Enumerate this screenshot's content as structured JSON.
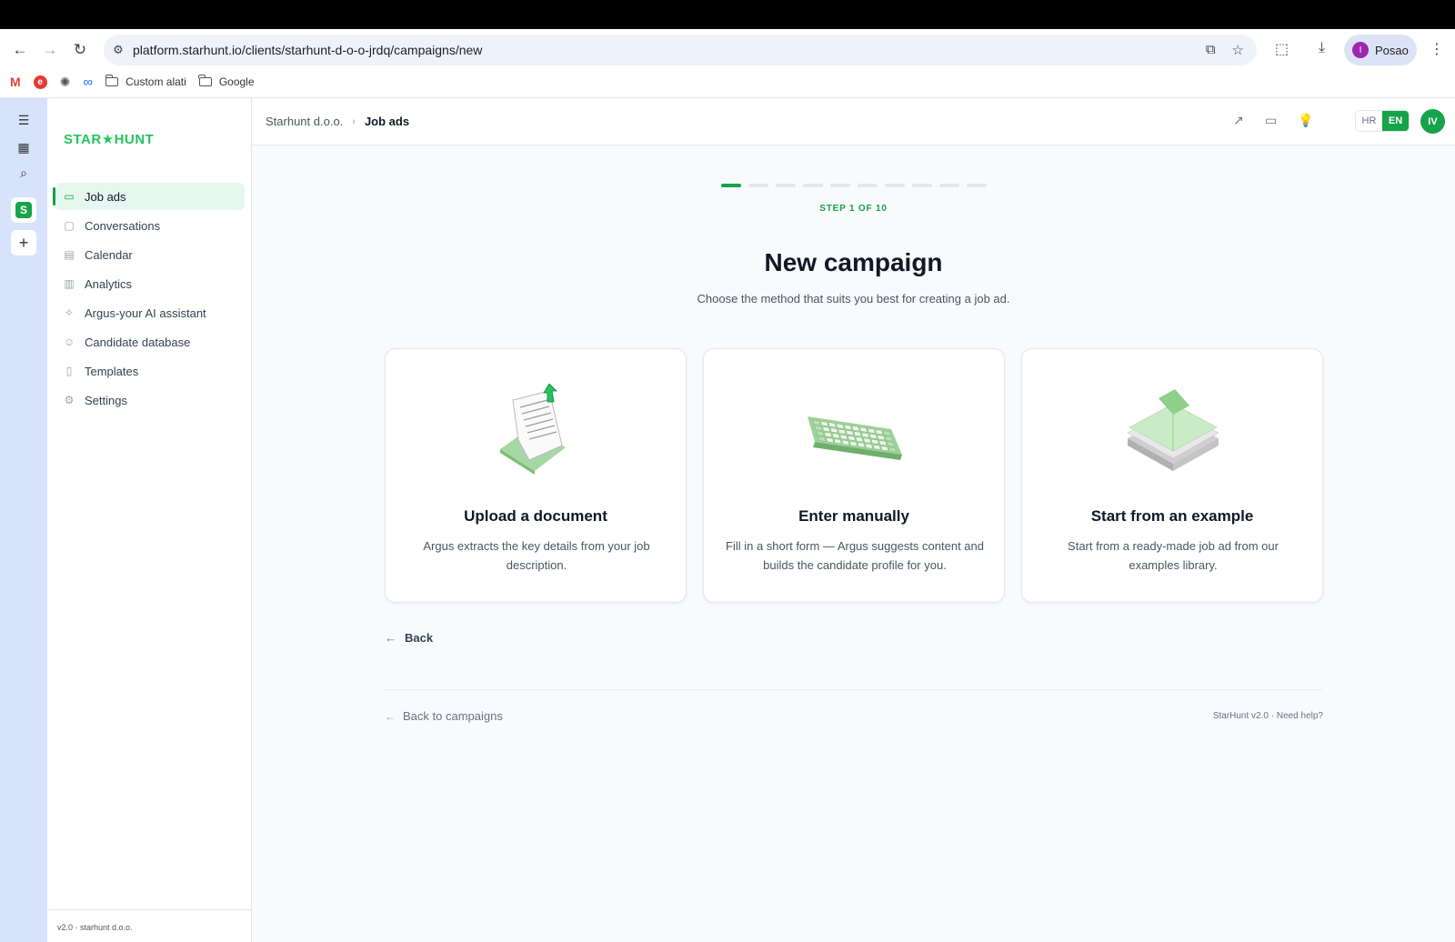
{
  "browser": {
    "url": "platform.starhunt.io/clients/starhunt-d-o-o-jrdq/campaigns/new",
    "profile_initial": "I",
    "profile_name": "Posao",
    "bookmarks": [
      {
        "icon": "gmail-icon"
      },
      {
        "icon": "e-icon",
        "text": "e"
      },
      {
        "icon": "openai-icon"
      },
      {
        "icon": "meta-icon"
      },
      {
        "icon": "folder-icon",
        "label": "Custom alati"
      },
      {
        "icon": "folder-icon",
        "label": "Google"
      }
    ]
  },
  "rail": {
    "items": [
      {
        "icon": "indent-icon"
      },
      {
        "icon": "grid-icon"
      },
      {
        "icon": "search-list-icon"
      },
      {
        "icon": "starhunt-app-icon",
        "text": "S"
      },
      {
        "icon": "plus-icon"
      }
    ]
  },
  "sidebar": {
    "logo": "STAR★HUNT",
    "items": [
      {
        "label": "Job ads",
        "icon": "folder-icon",
        "active": true
      },
      {
        "label": "Conversations",
        "icon": "chat-icon"
      },
      {
        "label": "Calendar",
        "icon": "calendar-icon"
      },
      {
        "label": "Analytics",
        "icon": "bar-chart-icon"
      },
      {
        "label": "Argus-your AI assistant",
        "icon": "sparkles-icon"
      },
      {
        "label": "Candidate database",
        "icon": "users-icon"
      },
      {
        "label": "Templates",
        "icon": "document-icon"
      },
      {
        "label": "Settings",
        "icon": "gear-icon"
      }
    ],
    "footer": "v2.0 · starhunt d.o.o."
  },
  "header": {
    "breadcrumb_org": "Starhunt d.o.o.",
    "breadcrumb_current": "Job ads",
    "lang_hr": "HR",
    "lang_en": "EN",
    "avatar": "IV",
    "accent": "#16a34a"
  },
  "wizard": {
    "step_current": 1,
    "step_total": 10,
    "step_label": "STEP 1 OF 10",
    "title": "New campaign",
    "subtitle": "Choose the method that suits you best for creating a job ad.",
    "options": [
      {
        "title": "Upload a document",
        "desc": "Argus extracts the key details from your job description.",
        "art": "document-upload-illustration"
      },
      {
        "title": "Enter manually",
        "desc": "Fill in a short form — Argus suggests content and builds the candidate profile for you.",
        "art": "keyboard-illustration"
      },
      {
        "title": "Start from an example",
        "desc": "Start from a ready-made job ad from our examples library.",
        "art": "paper-stack-illustration"
      }
    ],
    "back_label": "Back",
    "back_campaigns_label": "Back to campaigns",
    "footer_right": "StarHunt v2.0 · Need help?"
  }
}
